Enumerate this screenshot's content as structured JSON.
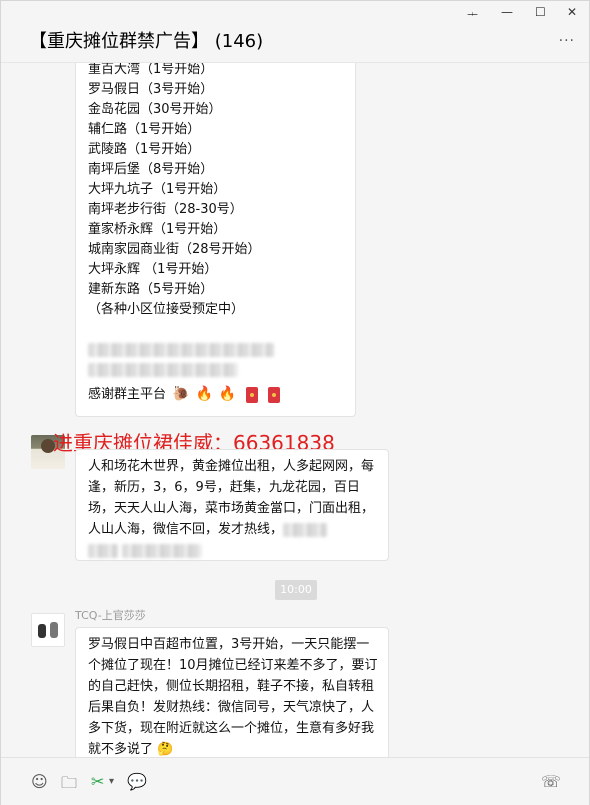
{
  "window": {
    "title": "【重庆摊位群禁广告】 (146)",
    "controls": {
      "pin": "ᆠ",
      "minimize": "—",
      "maximize": "☐",
      "close": "✕"
    },
    "more": "···"
  },
  "messages": {
    "first": {
      "lines": [
        "重百大湾（1号开始）",
        "罗马假日（3号开始）",
        "金岛花园（30号开始）",
        "辅仁路（1号开始）",
        "武陵路（1号开始）",
        "南坪后堡（8号开始）",
        "大坪九坑子（1号开始）",
        "南坪老步行街（28-30号）",
        "童家桥永辉（1号开始）",
        "城南家园商业街（28号开始）",
        "大坪永辉 （1号开始）",
        "建新东路（5号开始）",
        "（各种小区位接受预定中）"
      ],
      "thanks": "感谢群主平台"
    },
    "overlay_red": "进重庆摊位裙佳威：66361838",
    "second": {
      "text": "人和场花木世界，黄金摊位出租，人多起网网，每逢，新历，3，6，9号，赶集，九龙花园，百日场，天天人山人海，菜市场黄金當口，门面出租，人山人海，微信不回，发才热线，"
    },
    "time": "10:00",
    "third": {
      "sender": "TCQ-上官莎莎",
      "text": "罗马假日中百超市位置，3号开始，一天只能摆一个摊位了现在！10月摊位已经订来差不多了，要订的自己赶快，侧位长期招租，鞋子不接，私自转租后果自负！发财热线：微信同号，天气凉快了，人多下货，现在附近就这么一个摊位，生意有多好我就不多说了"
    }
  },
  "toolbar": {
    "emoji_icon": "☺",
    "folder_icon": "🗀",
    "scissors_icon": "✂",
    "chat_icon": "💬",
    "phone_icon": "☏"
  },
  "colors": {
    "accent_red": "#e02020",
    "bubble_bg": "#ffffff",
    "window_bg": "#f5f5f5"
  }
}
